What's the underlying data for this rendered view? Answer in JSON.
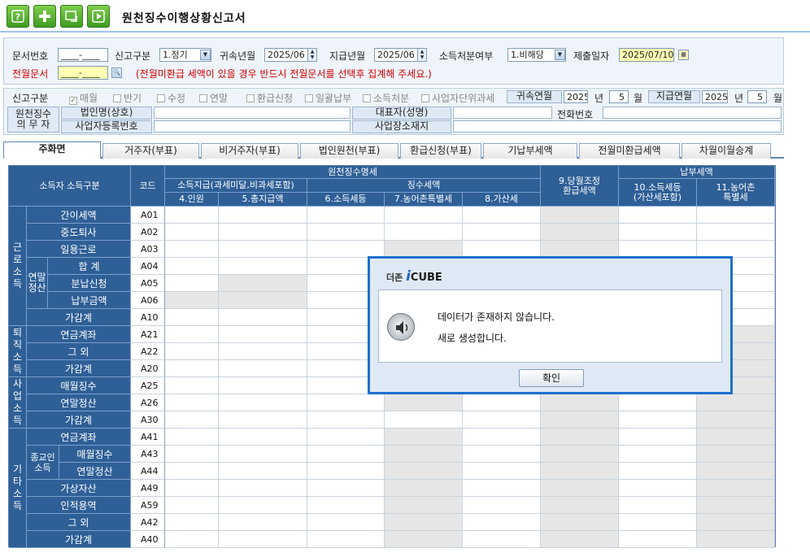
{
  "window": {
    "title": "원천징수이행상황신고서"
  },
  "toolbar": {
    "buttons": [
      "help-icon",
      "add-icon",
      "refresh-icon",
      "play-icon"
    ]
  },
  "header": {
    "doc_no_label": "문서번호",
    "doc_no_value": "____-____",
    "report_type_label": "신고구분",
    "report_type_value": "1.정기",
    "belong_ym_label": "귀속년월",
    "belong_ym_value": "2025/06",
    "pay_ym_label": "지급년월",
    "pay_ym_value": "2025/06",
    "income_disp_label": "소득처분여부",
    "income_disp_value": "1.비해당",
    "submit_date_label": "제출일자",
    "submit_date_value": "2025/07/10",
    "prev_doc_label": "전월문서",
    "prev_doc_value": "____-____",
    "notice": "(전월미환급 세액이 있을 경우 반드시 전월문서를 선택후 집계해 주세요.)"
  },
  "sub": {
    "report_kind_label": "신고구분",
    "checks": [
      {
        "label": "매월",
        "checked": true
      },
      {
        "label": "반기",
        "checked": false
      },
      {
        "label": "수정",
        "checked": false
      },
      {
        "label": "연말",
        "checked": false
      },
      {
        "label": "환급신청",
        "checked": false
      },
      {
        "label": "일괄납부",
        "checked": false
      },
      {
        "label": "소득처분",
        "checked": false
      },
      {
        "label": "사업자단위과세",
        "checked": false
      }
    ],
    "belong_ym_label": "귀속연월",
    "belong_year": "2025",
    "year_unit": "년",
    "belong_month": "5",
    "month_unit": "월",
    "pay_ym_label": "지급연월",
    "pay_year": "2025",
    "pay_year_unit": "년",
    "pay_month": "5",
    "pay_month_unit": "월",
    "withholder_label": "원천징수\n의 무 자",
    "corp_name_label": "법인명(상호)",
    "rep_label": "대표자(성명)",
    "phone_label": "전화번호",
    "biz_no_label": "사업자등록번호",
    "address_label": "사업장소재지"
  },
  "tabs": [
    "주화면",
    "거주자(부표)",
    "비거주자(부표)",
    "법인원천(부표)",
    "환급신청(부표)",
    "기납부세액",
    "전월미환급세액",
    "차월이월승계"
  ],
  "grid": {
    "headers": {
      "income_type": "소득자 소득구분",
      "code": "코드",
      "detail": "원천징수명세",
      "payment": "소득지급(과세미달,비과세포함)",
      "tax": "징수세액",
      "persons": "4.인원",
      "total": "5.총지급액",
      "income_tax": "6.소득세등",
      "rural": "7.농어촌특별세",
      "penalty": "8.가산세",
      "adjust": "9.당월조정\n환급세액",
      "pay_tax": "납부세액",
      "pay_income": "10.소득세등\n(가산세포함)",
      "pay_rural": "11.농어촌\n특별세"
    },
    "groups": [
      {
        "label": "근\n로\n소\n득"
      },
      {
        "label": "퇴\n직\n소\n득"
      },
      {
        "label": "사\n업\n소\n득"
      },
      {
        "label": "기\n타\n소\n득"
      }
    ],
    "subgroups": [
      {
        "label": "연말\n정산"
      },
      {
        "label": "종교인\n소득"
      }
    ],
    "rows": [
      {
        "name": "간이세액",
        "code": "A01"
      },
      {
        "name": "중도퇴사",
        "code": "A02"
      },
      {
        "name": "일용근로",
        "code": "A03"
      },
      {
        "name": "합    계",
        "code": "A04"
      },
      {
        "name": "분납신청",
        "code": "A05"
      },
      {
        "name": "납부금액",
        "code": "A06"
      },
      {
        "name": "가감계",
        "code": "A10"
      },
      {
        "name": "연금계좌",
        "code": "A21"
      },
      {
        "name": "그    외",
        "code": "A22"
      },
      {
        "name": "가감계",
        "code": "A20"
      },
      {
        "name": "매월징수",
        "code": "A25"
      },
      {
        "name": "연말정산",
        "code": "A26"
      },
      {
        "name": "가감계",
        "code": "A30"
      },
      {
        "name": "연금계좌",
        "code": "A41"
      },
      {
        "name": "매월징수",
        "code": "A43"
      },
      {
        "name": "연말정산",
        "code": "A44"
      },
      {
        "name": "가상자산",
        "code": "A49"
      },
      {
        "name": "인적용역",
        "code": "A59"
      },
      {
        "name": "그    외",
        "code": "A42"
      },
      {
        "name": "가감계",
        "code": "A40"
      }
    ]
  },
  "dialog": {
    "brand_prefix": "더존",
    "brand_i": "i",
    "brand_name": "CUBE",
    "message1": "데이터가 존재하지 않습니다.",
    "message2": "새로 생성합니다.",
    "ok_label": "확인"
  }
}
